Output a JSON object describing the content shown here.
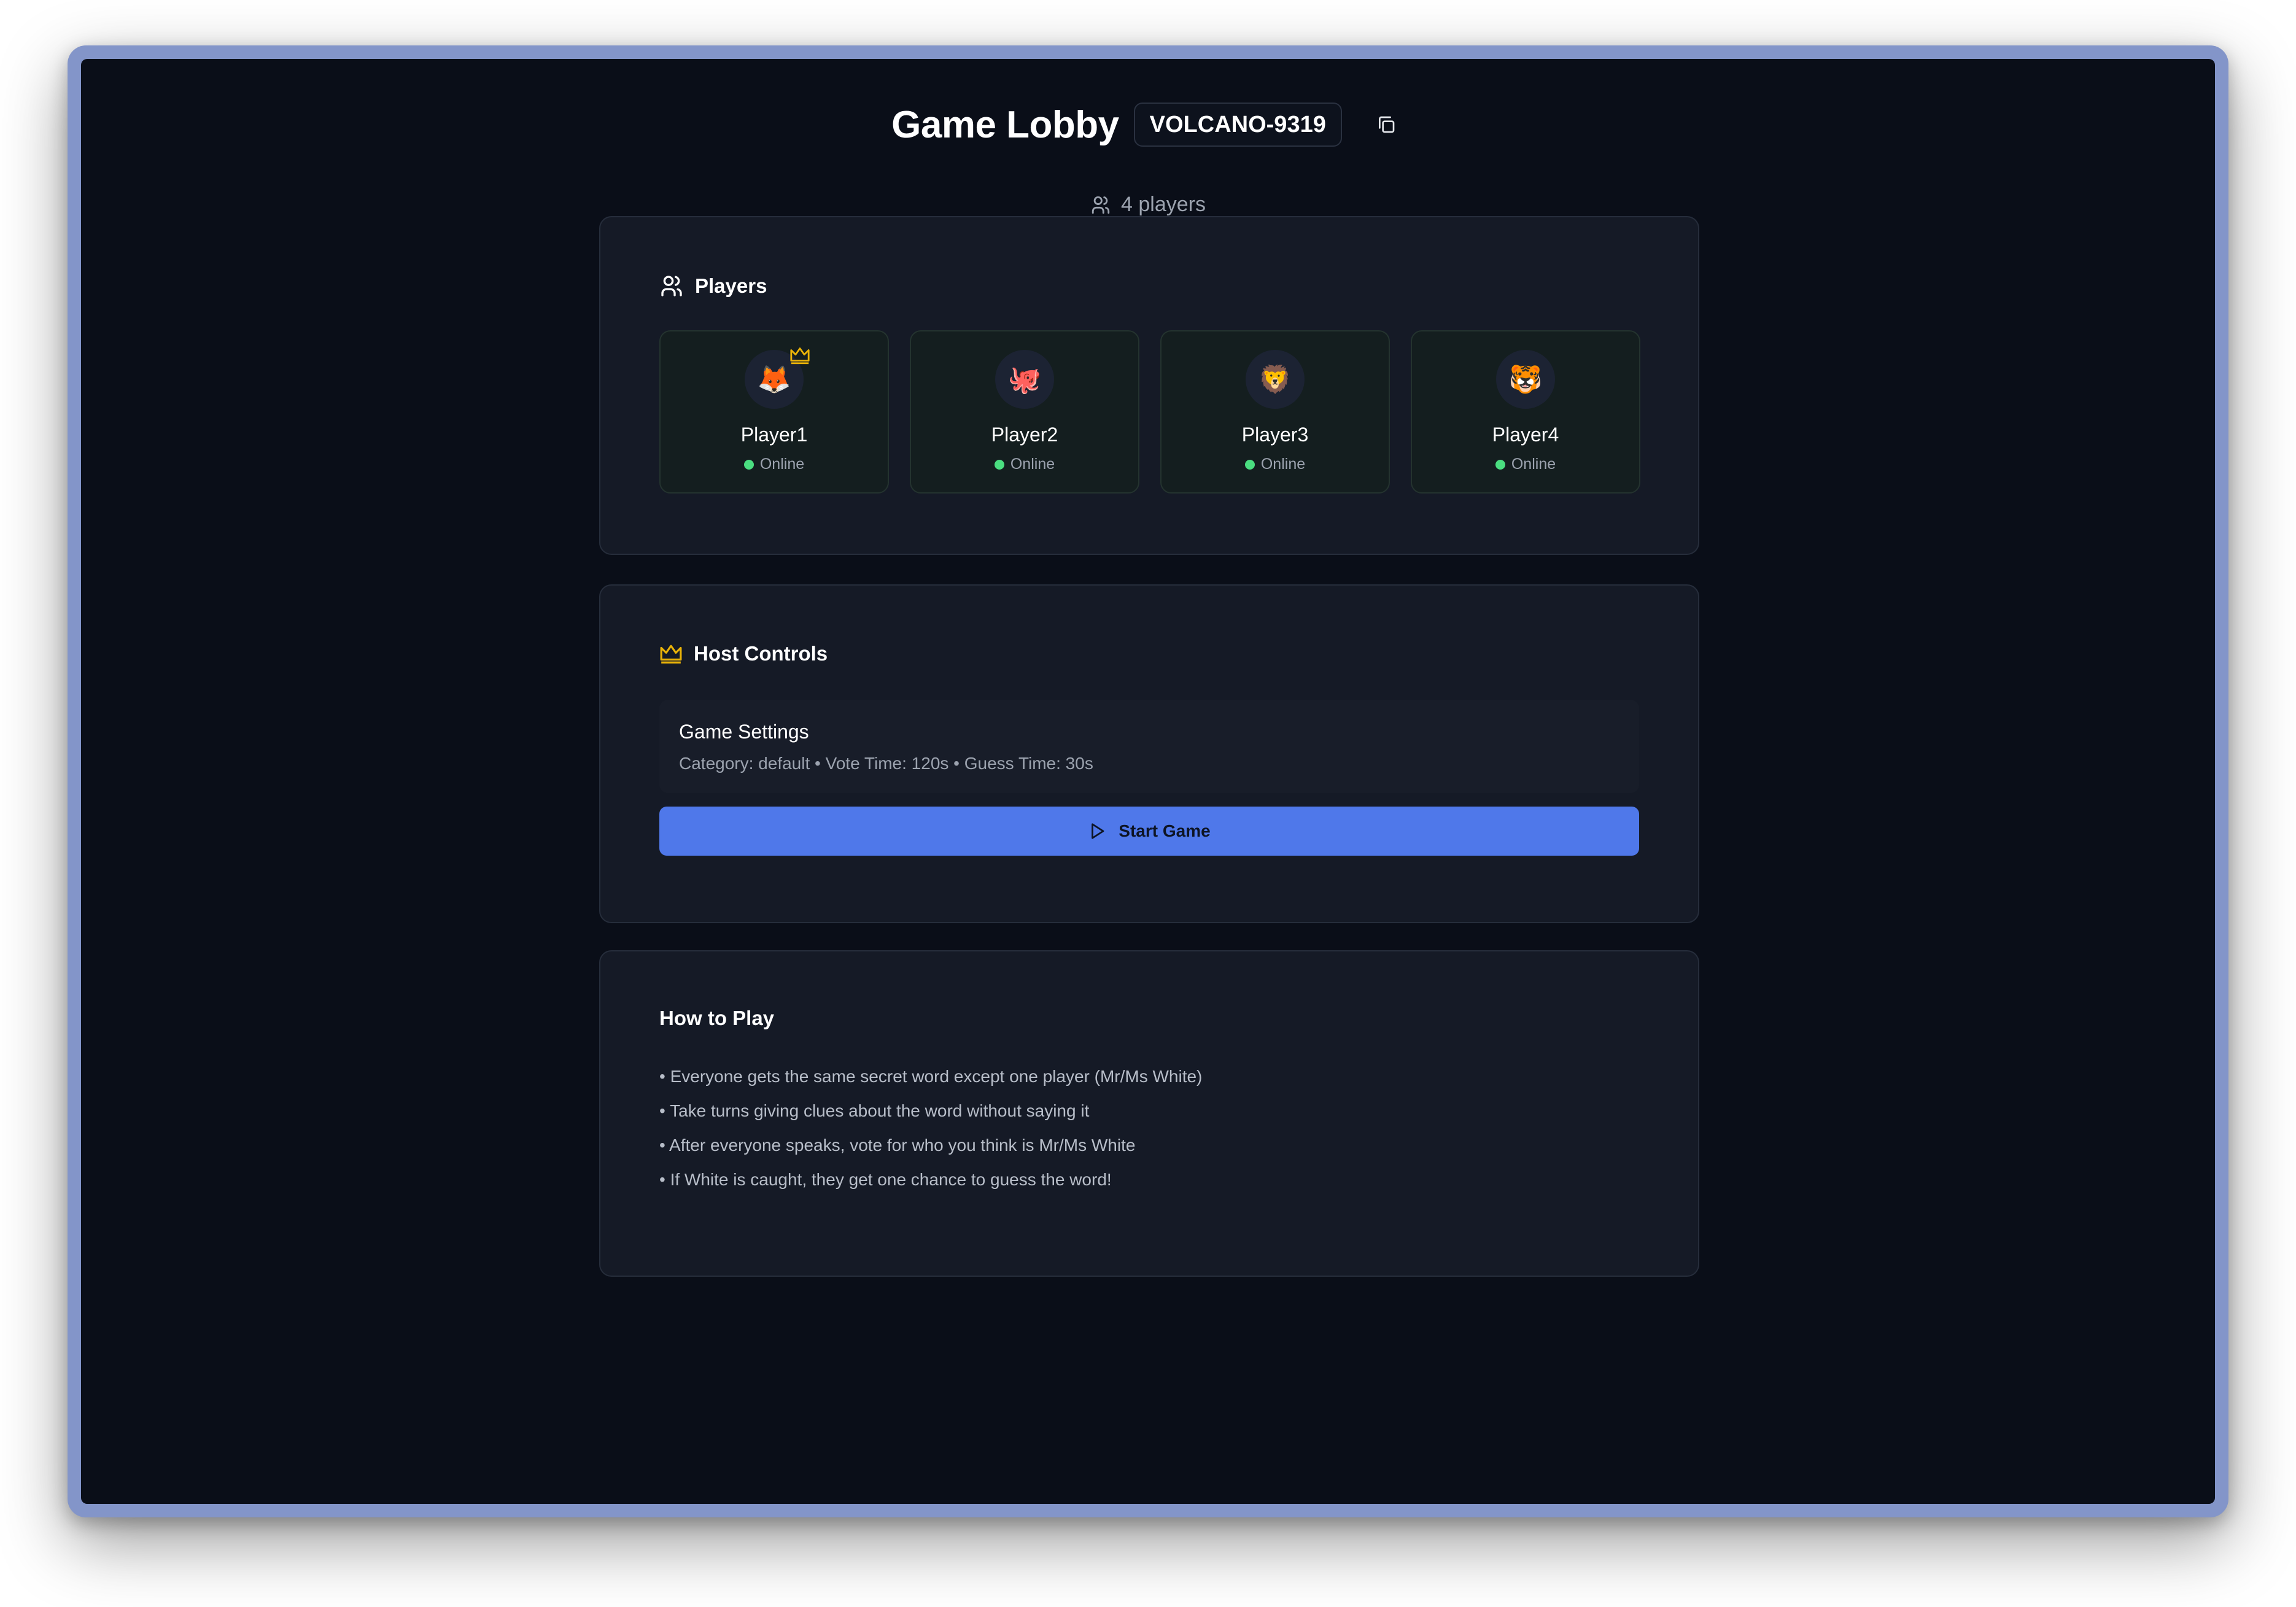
{
  "header": {
    "title": "Game Lobby",
    "room_code": "VOLCANO-9319",
    "player_count": "4 players"
  },
  "players_section": {
    "title": "Players",
    "players": [
      {
        "name": "Player1",
        "avatar": "🦊",
        "status": "Online",
        "is_host": true
      },
      {
        "name": "Player2",
        "avatar": "🐙",
        "status": "Online",
        "is_host": false
      },
      {
        "name": "Player3",
        "avatar": "🦁",
        "status": "Online",
        "is_host": false
      },
      {
        "name": "Player4",
        "avatar": "🐯",
        "status": "Online",
        "is_host": false
      }
    ]
  },
  "host_controls": {
    "title": "Host Controls",
    "settings_title": "Game Settings",
    "settings_summary": "Category: default • Vote Time: 120s • Guess Time: 30s",
    "start_label": "Start Game"
  },
  "how_to_play": {
    "title": "How to Play",
    "rules": [
      "• Everyone gets the same secret word except one player (Mr/Ms White)",
      "• Take turns giving clues about the word without saying it",
      "• After everyone speaks, vote for who you think is Mr/Ms White",
      "• If White is caught, they get one chance to guess the word!"
    ]
  },
  "colors": {
    "background": "#0a0e18",
    "card": "#151a26",
    "accent_blue": "#4f78ea",
    "crown_gold": "#eab308",
    "online_green": "#4ade80"
  }
}
